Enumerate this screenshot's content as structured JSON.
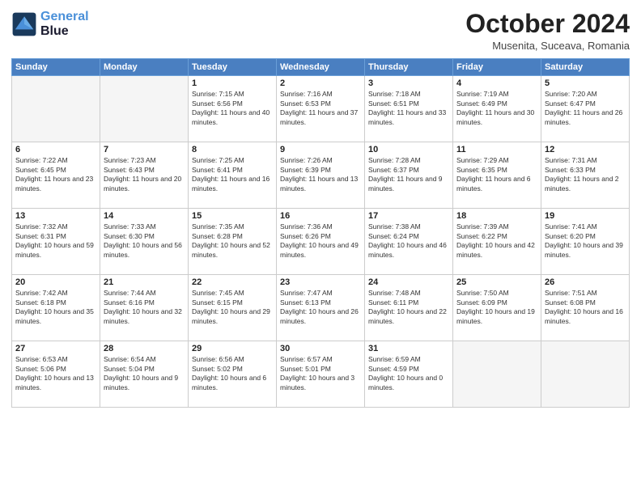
{
  "header": {
    "title": "October 2024",
    "location": "Musenita, Suceava, Romania",
    "logo_line1": "General",
    "logo_line2": "Blue"
  },
  "days_of_week": [
    "Sunday",
    "Monday",
    "Tuesday",
    "Wednesday",
    "Thursday",
    "Friday",
    "Saturday"
  ],
  "weeks": [
    [
      {
        "day": "",
        "empty": true
      },
      {
        "day": "",
        "empty": true
      },
      {
        "day": "1",
        "sunrise": "Sunrise: 7:15 AM",
        "sunset": "Sunset: 6:56 PM",
        "daylight": "Daylight: 11 hours and 40 minutes."
      },
      {
        "day": "2",
        "sunrise": "Sunrise: 7:16 AM",
        "sunset": "Sunset: 6:53 PM",
        "daylight": "Daylight: 11 hours and 37 minutes."
      },
      {
        "day": "3",
        "sunrise": "Sunrise: 7:18 AM",
        "sunset": "Sunset: 6:51 PM",
        "daylight": "Daylight: 11 hours and 33 minutes."
      },
      {
        "day": "4",
        "sunrise": "Sunrise: 7:19 AM",
        "sunset": "Sunset: 6:49 PM",
        "daylight": "Daylight: 11 hours and 30 minutes."
      },
      {
        "day": "5",
        "sunrise": "Sunrise: 7:20 AM",
        "sunset": "Sunset: 6:47 PM",
        "daylight": "Daylight: 11 hours and 26 minutes."
      }
    ],
    [
      {
        "day": "6",
        "sunrise": "Sunrise: 7:22 AM",
        "sunset": "Sunset: 6:45 PM",
        "daylight": "Daylight: 11 hours and 23 minutes."
      },
      {
        "day": "7",
        "sunrise": "Sunrise: 7:23 AM",
        "sunset": "Sunset: 6:43 PM",
        "daylight": "Daylight: 11 hours and 20 minutes."
      },
      {
        "day": "8",
        "sunrise": "Sunrise: 7:25 AM",
        "sunset": "Sunset: 6:41 PM",
        "daylight": "Daylight: 11 hours and 16 minutes."
      },
      {
        "day": "9",
        "sunrise": "Sunrise: 7:26 AM",
        "sunset": "Sunset: 6:39 PM",
        "daylight": "Daylight: 11 hours and 13 minutes."
      },
      {
        "day": "10",
        "sunrise": "Sunrise: 7:28 AM",
        "sunset": "Sunset: 6:37 PM",
        "daylight": "Daylight: 11 hours and 9 minutes."
      },
      {
        "day": "11",
        "sunrise": "Sunrise: 7:29 AM",
        "sunset": "Sunset: 6:35 PM",
        "daylight": "Daylight: 11 hours and 6 minutes."
      },
      {
        "day": "12",
        "sunrise": "Sunrise: 7:31 AM",
        "sunset": "Sunset: 6:33 PM",
        "daylight": "Daylight: 11 hours and 2 minutes."
      }
    ],
    [
      {
        "day": "13",
        "sunrise": "Sunrise: 7:32 AM",
        "sunset": "Sunset: 6:31 PM",
        "daylight": "Daylight: 10 hours and 59 minutes."
      },
      {
        "day": "14",
        "sunrise": "Sunrise: 7:33 AM",
        "sunset": "Sunset: 6:30 PM",
        "daylight": "Daylight: 10 hours and 56 minutes."
      },
      {
        "day": "15",
        "sunrise": "Sunrise: 7:35 AM",
        "sunset": "Sunset: 6:28 PM",
        "daylight": "Daylight: 10 hours and 52 minutes."
      },
      {
        "day": "16",
        "sunrise": "Sunrise: 7:36 AM",
        "sunset": "Sunset: 6:26 PM",
        "daylight": "Daylight: 10 hours and 49 minutes."
      },
      {
        "day": "17",
        "sunrise": "Sunrise: 7:38 AM",
        "sunset": "Sunset: 6:24 PM",
        "daylight": "Daylight: 10 hours and 46 minutes."
      },
      {
        "day": "18",
        "sunrise": "Sunrise: 7:39 AM",
        "sunset": "Sunset: 6:22 PM",
        "daylight": "Daylight: 10 hours and 42 minutes."
      },
      {
        "day": "19",
        "sunrise": "Sunrise: 7:41 AM",
        "sunset": "Sunset: 6:20 PM",
        "daylight": "Daylight: 10 hours and 39 minutes."
      }
    ],
    [
      {
        "day": "20",
        "sunrise": "Sunrise: 7:42 AM",
        "sunset": "Sunset: 6:18 PM",
        "daylight": "Daylight: 10 hours and 35 minutes."
      },
      {
        "day": "21",
        "sunrise": "Sunrise: 7:44 AM",
        "sunset": "Sunset: 6:16 PM",
        "daylight": "Daylight: 10 hours and 32 minutes."
      },
      {
        "day": "22",
        "sunrise": "Sunrise: 7:45 AM",
        "sunset": "Sunset: 6:15 PM",
        "daylight": "Daylight: 10 hours and 29 minutes."
      },
      {
        "day": "23",
        "sunrise": "Sunrise: 7:47 AM",
        "sunset": "Sunset: 6:13 PM",
        "daylight": "Daylight: 10 hours and 26 minutes."
      },
      {
        "day": "24",
        "sunrise": "Sunrise: 7:48 AM",
        "sunset": "Sunset: 6:11 PM",
        "daylight": "Daylight: 10 hours and 22 minutes."
      },
      {
        "day": "25",
        "sunrise": "Sunrise: 7:50 AM",
        "sunset": "Sunset: 6:09 PM",
        "daylight": "Daylight: 10 hours and 19 minutes."
      },
      {
        "day": "26",
        "sunrise": "Sunrise: 7:51 AM",
        "sunset": "Sunset: 6:08 PM",
        "daylight": "Daylight: 10 hours and 16 minutes."
      }
    ],
    [
      {
        "day": "27",
        "sunrise": "Sunrise: 6:53 AM",
        "sunset": "Sunset: 5:06 PM",
        "daylight": "Daylight: 10 hours and 13 minutes."
      },
      {
        "day": "28",
        "sunrise": "Sunrise: 6:54 AM",
        "sunset": "Sunset: 5:04 PM",
        "daylight": "Daylight: 10 hours and 9 minutes."
      },
      {
        "day": "29",
        "sunrise": "Sunrise: 6:56 AM",
        "sunset": "Sunset: 5:02 PM",
        "daylight": "Daylight: 10 hours and 6 minutes."
      },
      {
        "day": "30",
        "sunrise": "Sunrise: 6:57 AM",
        "sunset": "Sunset: 5:01 PM",
        "daylight": "Daylight: 10 hours and 3 minutes."
      },
      {
        "day": "31",
        "sunrise": "Sunrise: 6:59 AM",
        "sunset": "Sunset: 4:59 PM",
        "daylight": "Daylight: 10 hours and 0 minutes."
      },
      {
        "day": "",
        "empty": true
      },
      {
        "day": "",
        "empty": true
      }
    ]
  ]
}
